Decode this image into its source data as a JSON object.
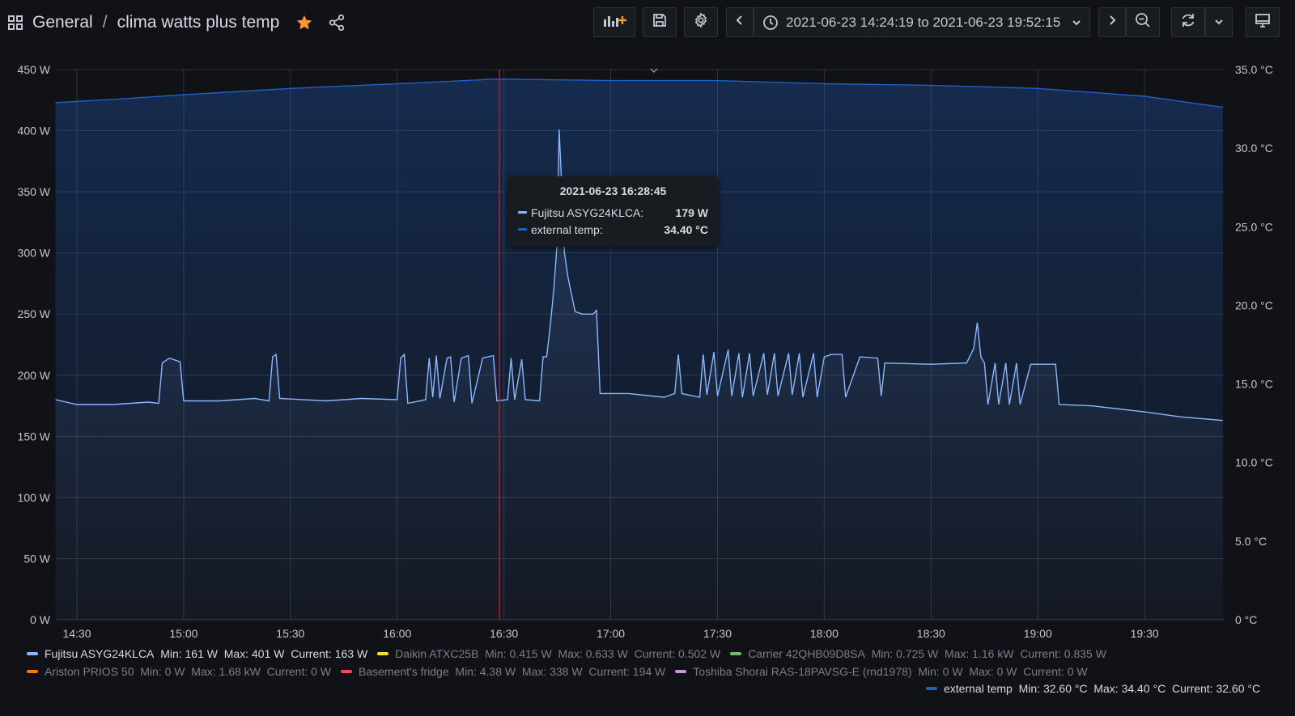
{
  "header": {
    "folder": "General",
    "separator": "/",
    "dashboard_title": "clima watts plus temp",
    "time_range": "2021-06-23 14:24:19 to 2021-06-23 19:52:15"
  },
  "colors": {
    "fujitsu": "#8ab8ff",
    "external_temp": "#1f60c4",
    "cursor": "#c4162a",
    "star": "#ff9830"
  },
  "tooltip": {
    "time": "2021-06-23 16:28:45",
    "rows": [
      {
        "name": "Fujitsu ASYG24KLCA:",
        "value": "179 W"
      },
      {
        "name": "external temp:",
        "value": "34.40 °C"
      }
    ]
  },
  "legend": [
    {
      "name": "Fujitsu ASYG24KLCA",
      "stats": "Min: 161 W  Max: 401 W  Current: 163 W",
      "color": "#8ab8ff",
      "visible": true
    },
    {
      "name": "Daikin ATXC25B",
      "stats": "Min: 0.415 W  Max: 0.633 W  Current: 0.502 W",
      "color": "#fade2a",
      "visible": false
    },
    {
      "name": "Carrier 42QHB09D8SA",
      "stats": "Min: 0.725 W  Max: 1.16 kW  Current: 0.835 W",
      "color": "#73bf69",
      "visible": false
    },
    {
      "name": "Ariston PRIOS 50",
      "stats": "Min: 0 W  Max: 1.68 kW  Current: 0 W",
      "color": "#ff780a",
      "visible": false
    },
    {
      "name": "Basement's fridge",
      "stats": "Min: 4.38 W  Max: 338 W  Current: 194 W",
      "color": "#f2495c",
      "visible": false
    },
    {
      "name": "Toshiba Shorai RAS-18PAVSG-E (rnd1978)",
      "stats": "Min: 0 W  Max: 0 W  Current: 0 W",
      "color": "#ca95e5",
      "visible": false
    },
    {
      "name": "external temp",
      "stats": "Min: 32.60 °C  Max: 34.40 °C  Current: 32.60 °C",
      "color": "#1f60c4",
      "visible": true
    }
  ],
  "chart_data": {
    "type": "line",
    "x_range": [
      "14:24:19",
      "19:52:15"
    ],
    "x_ticks": [
      "14:30",
      "15:00",
      "15:30",
      "16:00",
      "16:30",
      "17:00",
      "17:30",
      "18:00",
      "18:30",
      "19:00",
      "19:30"
    ],
    "y_left_ticks": [
      "0 W",
      "50 W",
      "100 W",
      "150 W",
      "200 W",
      "250 W",
      "300 W",
      "350 W",
      "400 W",
      "450 W"
    ],
    "y_left_range": [
      0,
      450
    ],
    "y_right_ticks": [
      "0 °C",
      "5.0 °C",
      "10.0 °C",
      "15.0 °C",
      "20.0 °C",
      "25.0 °C",
      "30.0 °C",
      "35.0 °C"
    ],
    "y_right_range": [
      0,
      35
    ],
    "cursor_time": "16:28:45",
    "series": [
      {
        "name": "Fujitsu ASYG24KLCA",
        "axis": "left",
        "color": "#8ab8ff",
        "points": [
          [
            "14:24",
            180
          ],
          [
            "14:30",
            176
          ],
          [
            "14:40",
            176
          ],
          [
            "14:50",
            178
          ],
          [
            "14:53",
            177
          ],
          [
            "14:54",
            210
          ],
          [
            "14:56",
            214
          ],
          [
            "14:59",
            211
          ],
          [
            "15:00",
            179
          ],
          [
            "15:10",
            179
          ],
          [
            "15:20",
            181
          ],
          [
            "15:24",
            179
          ],
          [
            "15:25",
            215
          ],
          [
            "15:26",
            217
          ],
          [
            "15:27",
            181
          ],
          [
            "15:40",
            179
          ],
          [
            "15:50",
            181
          ],
          [
            "16:00",
            180
          ],
          [
            "16:01",
            214
          ],
          [
            "16:02",
            217
          ],
          [
            "16:03",
            177
          ],
          [
            "16:08",
            180
          ],
          [
            "16:09",
            214
          ],
          [
            "16:10",
            182
          ],
          [
            "16:11",
            216
          ],
          [
            "16:12",
            181
          ],
          [
            "16:14",
            214
          ],
          [
            "16:15",
            215
          ],
          [
            "16:16",
            178
          ],
          [
            "16:18",
            214
          ],
          [
            "16:20",
            216
          ],
          [
            "16:21",
            177
          ],
          [
            "16:24",
            214
          ],
          [
            "16:27",
            216
          ],
          [
            "16:28",
            179
          ],
          [
            "16:31",
            180
          ],
          [
            "16:32",
            214
          ],
          [
            "16:33",
            180
          ],
          [
            "16:35",
            213
          ],
          [
            "16:36",
            180
          ],
          [
            "16:40",
            179
          ],
          [
            "16:41",
            215
          ],
          [
            "16:42",
            215
          ],
          [
            "16:43",
            240
          ],
          [
            "16:44",
            270
          ],
          [
            "16:45",
            310
          ],
          [
            "16:45:30",
            401
          ],
          [
            "16:46",
            370
          ],
          [
            "16:47",
            300
          ],
          [
            "16:48",
            280
          ],
          [
            "16:50",
            252
          ],
          [
            "16:52",
            250
          ],
          [
            "16:55",
            250
          ],
          [
            "16:56",
            253
          ],
          [
            "16:57",
            185
          ],
          [
            "17:05",
            185
          ],
          [
            "17:15",
            182
          ],
          [
            "17:18",
            185
          ],
          [
            "17:19",
            217
          ],
          [
            "17:20",
            185
          ],
          [
            "17:25",
            182
          ],
          [
            "17:26",
            217
          ],
          [
            "17:27",
            184
          ],
          [
            "17:29",
            219
          ],
          [
            "17:30",
            183
          ],
          [
            "17:33",
            221
          ],
          [
            "17:34",
            183
          ],
          [
            "17:36",
            218
          ],
          [
            "17:37",
            182
          ],
          [
            "17:39",
            218
          ],
          [
            "17:40",
            183
          ],
          [
            "17:43",
            218
          ],
          [
            "17:44",
            184
          ],
          [
            "17:46",
            218
          ],
          [
            "17:47",
            183
          ],
          [
            "17:50",
            218
          ],
          [
            "17:51",
            184
          ],
          [
            "17:53",
            218
          ],
          [
            "17:54",
            182
          ],
          [
            "17:57",
            218
          ],
          [
            "17:58",
            182
          ],
          [
            "18:00",
            215
          ],
          [
            "18:02",
            217
          ],
          [
            "18:05",
            217
          ],
          [
            "18:06",
            182
          ],
          [
            "18:10",
            215
          ],
          [
            "18:15",
            214
          ],
          [
            "18:16",
            183
          ],
          [
            "18:17",
            210
          ],
          [
            "18:30",
            209
          ],
          [
            "18:40",
            210
          ],
          [
            "18:42",
            222
          ],
          [
            "18:43",
            243
          ],
          [
            "18:44",
            215
          ],
          [
            "18:45",
            210
          ],
          [
            "18:46",
            176
          ],
          [
            "18:48",
            210
          ],
          [
            "18:49",
            176
          ],
          [
            "18:51",
            210
          ],
          [
            "18:52",
            176
          ],
          [
            "18:54",
            210
          ],
          [
            "18:55",
            176
          ],
          [
            "18:58",
            209
          ],
          [
            "19:05",
            209
          ],
          [
            "19:06",
            176
          ],
          [
            "19:15",
            175
          ],
          [
            "19:30",
            170
          ],
          [
            "19:40",
            166
          ],
          [
            "19:52",
            163
          ]
        ]
      },
      {
        "name": "external temp",
        "axis": "right",
        "color": "#1f60c4",
        "points": [
          [
            "14:24",
            32.9
          ],
          [
            "14:40",
            33.1
          ],
          [
            "15:00",
            33.4
          ],
          [
            "15:30",
            33.8
          ],
          [
            "16:00",
            34.1
          ],
          [
            "16:28",
            34.4
          ],
          [
            "17:00",
            34.3
          ],
          [
            "17:30",
            34.3
          ],
          [
            "18:00",
            34.1
          ],
          [
            "18:30",
            34.0
          ],
          [
            "19:00",
            33.8
          ],
          [
            "19:30",
            33.3
          ],
          [
            "19:52",
            32.6
          ]
        ]
      }
    ]
  }
}
